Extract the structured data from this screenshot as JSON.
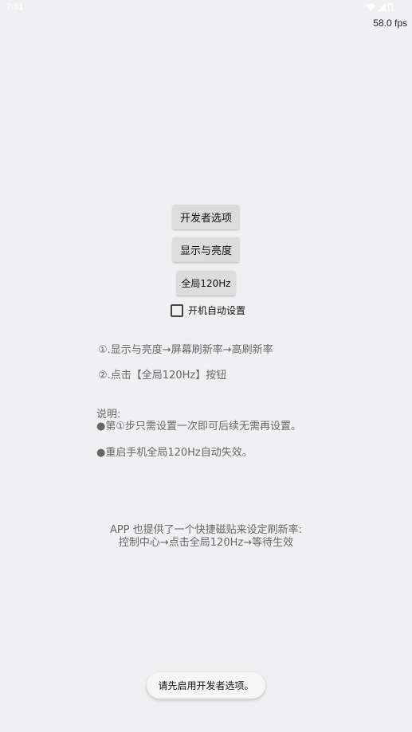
{
  "status_bar": {
    "time": "7:51",
    "icons": [
      "wifi-icon",
      "signal-icon",
      "battery-icon"
    ]
  },
  "fps_label": "58.0 fps",
  "buttons": {
    "developer_options": "开发者选项",
    "display_brightness": "显示与亮度",
    "global_120hz": "全局120Hz"
  },
  "checkbox": {
    "label": "开机自动设置",
    "checked": false
  },
  "steps": [
    "①.显示与亮度→屏幕刷新率→高刷新率",
    "②.点击【全局120Hz】按钮"
  ],
  "notes": {
    "title": "说明:",
    "items": [
      "●第①步只需设置一次即可后续无需再设置。",
      "●重启手机全局120Hz自动失效。"
    ]
  },
  "tips": [
    "APP 也提供了一个快捷磁贴来设定刷新率:",
    "控制中心→点击全局120Hz→等待生效"
  ],
  "toast": "请先启用开发者选项。"
}
